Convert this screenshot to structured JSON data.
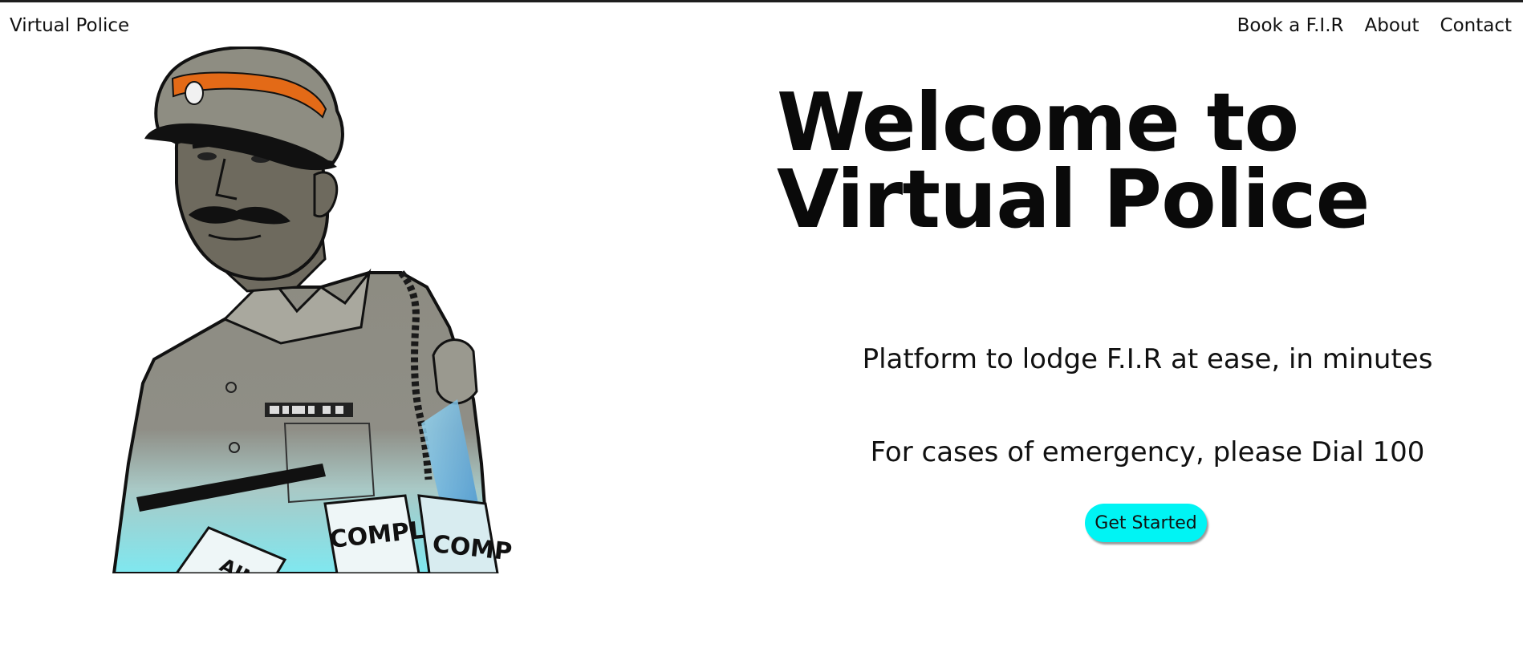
{
  "navbar": {
    "brand": "Virtual Police",
    "links": [
      {
        "label": "Book a F.I.R"
      },
      {
        "label": "About"
      },
      {
        "label": "Contact"
      }
    ]
  },
  "hero": {
    "title": "Welcome to Virtual Police",
    "subtitle_1": "Platform to lodge F.I.R at ease, in minutes",
    "subtitle_2": "For cases of emergency, please Dial 100",
    "cta_label": "Get Started",
    "image_icon": "police-officer-illustration",
    "papers_text": [
      "COMPLAINT",
      "COMP",
      "AINT"
    ]
  },
  "colors": {
    "cta_background": "#00f4f4",
    "uniform": "#8f8e84",
    "cap_band": "#e36a17",
    "skin": "#6e6a5e",
    "fade": "#7de6ee",
    "text": "#111111"
  }
}
